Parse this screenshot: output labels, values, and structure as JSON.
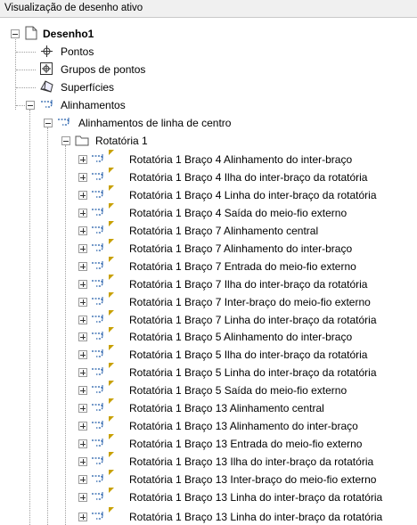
{
  "panel": {
    "title": "Visualização de desenho ativo"
  },
  "tree": {
    "root": "Desenho1",
    "pontos": "Pontos",
    "grupos": "Grupos de pontos",
    "superficies": "Superfícies",
    "alinhamentos": "Alinhamentos",
    "alinhamentos_centro": "Alinhamentos de linha de centro",
    "rotatoria": "Rotatória 1",
    "items": [
      "Rotatória 1 Braço 4 Alinhamento do inter-braço",
      "Rotatória 1 Braço 4 Ilha do inter-braço da rotatória",
      "Rotatória 1 Braço 4 Linha do inter-braço da rotatória",
      "Rotatória 1 Braço 4 Saída do meio-fio externo",
      "Rotatória 1 Braço 7 Alinhamento central",
      "Rotatória 1 Braço 7 Alinhamento do inter-braço",
      "Rotatória 1 Braço 7 Entrada do meio-fio externo",
      "Rotatória 1 Braço 7 Ilha do inter-braço da rotatória",
      "Rotatória 1 Braço 7 Inter-braço do meio-fio externo",
      "Rotatória 1 Braço 7 Linha do inter-braço da rotatória",
      "Rotatória 1 Braço 5 Alinhamento do inter-braço",
      "Rotatória 1 Braço 5 Ilha do inter-braço da rotatória",
      "Rotatória 1 Braço 5 Linha do inter-braço da rotatória",
      "Rotatória 1 Braço 5 Saída do meio-fio externo",
      "Rotatória 1 Braço 13 Alinhamento central",
      "Rotatória 1 Braço 13 Alinhamento do inter-braço",
      "Rotatória 1 Braço 13 Entrada do meio-fio externo",
      "Rotatória 1 Braço 13 Ilha do inter-braço da rotatória",
      "Rotatória 1 Braço 13 Inter-braço do meio-fio externo",
      "Rotatória 1 Braço 13 Linha do inter-braço da rotatória",
      "Rotatória 1 Braço 13 Linha do inter-braço da rotatória"
    ]
  },
  "colors": {
    "flag": "#c8a000",
    "alignment_icon": "#1e5aa8",
    "tree_lines": "#a0a0a0"
  }
}
